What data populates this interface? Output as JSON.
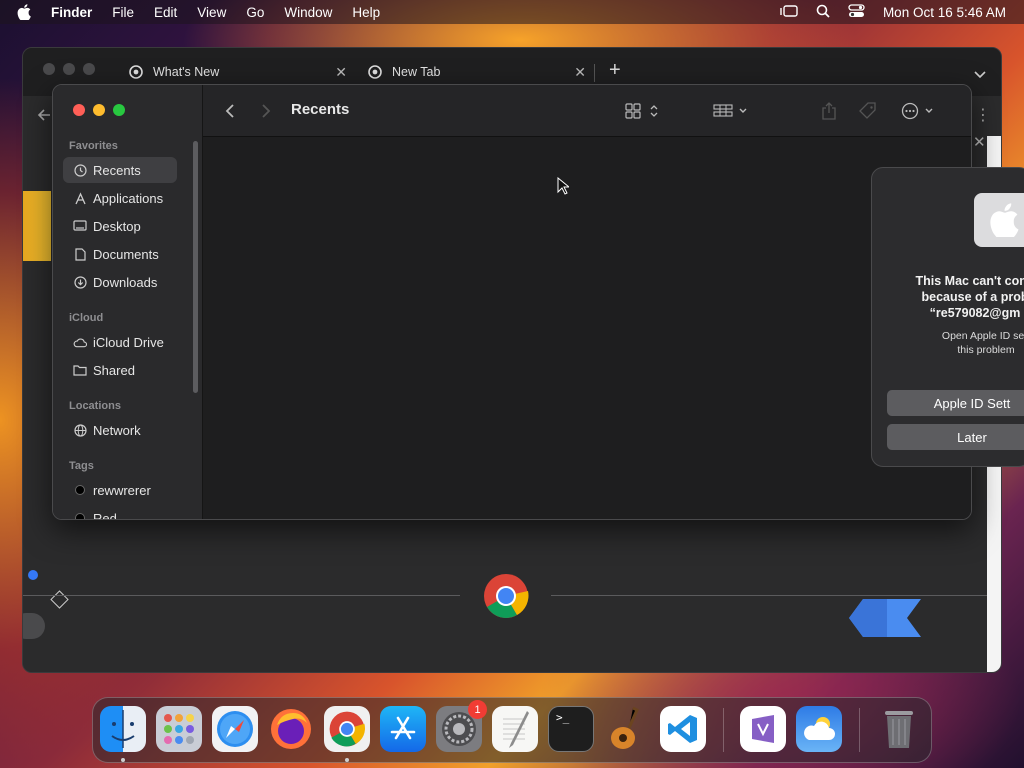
{
  "menubar": {
    "app_name": "Finder",
    "items": [
      "File",
      "Edit",
      "View",
      "Go",
      "Window",
      "Help"
    ],
    "datetime": "Mon Oct 16  5:46 AM"
  },
  "chrome": {
    "tabs": [
      {
        "label": "What's New"
      },
      {
        "label": "New Tab"
      }
    ],
    "new_tab_label": "+"
  },
  "finder": {
    "title": "Recents",
    "sections": {
      "favorites": "Favorites",
      "icloud": "iCloud",
      "locations": "Locations",
      "tags": "Tags"
    },
    "favorites": [
      "Recents",
      "Applications",
      "Desktop",
      "Documents",
      "Downloads"
    ],
    "icloud": [
      "iCloud Drive",
      "Shared"
    ],
    "locations": [
      "Network"
    ],
    "tags": [
      {
        "label": "rewwrerer",
        "color": "#000000"
      },
      {
        "label": "Red",
        "color": "#000000"
      }
    ]
  },
  "alert": {
    "line1": "This Mac can't conn",
    "line2": "because of a prob",
    "line3": "“re579082@gm",
    "sub1": "Open Apple ID sett",
    "sub2": "this problem",
    "primary_button": "Apple ID Sett",
    "secondary_button": "Later"
  },
  "dock": {
    "apps": [
      "finder",
      "launchpad",
      "safari",
      "firefox",
      "chrome",
      "app-store",
      "system-settings",
      "textedit",
      "terminal",
      "garageband",
      "vscode",
      "visual-studio",
      "weather",
      "trash"
    ],
    "system_settings_badge": "1"
  },
  "colors": {
    "accent_blue": "#3478f6",
    "close_red": "#ff5f57",
    "minimize_yellow": "#febc2e",
    "zoom_green": "#28c840"
  }
}
